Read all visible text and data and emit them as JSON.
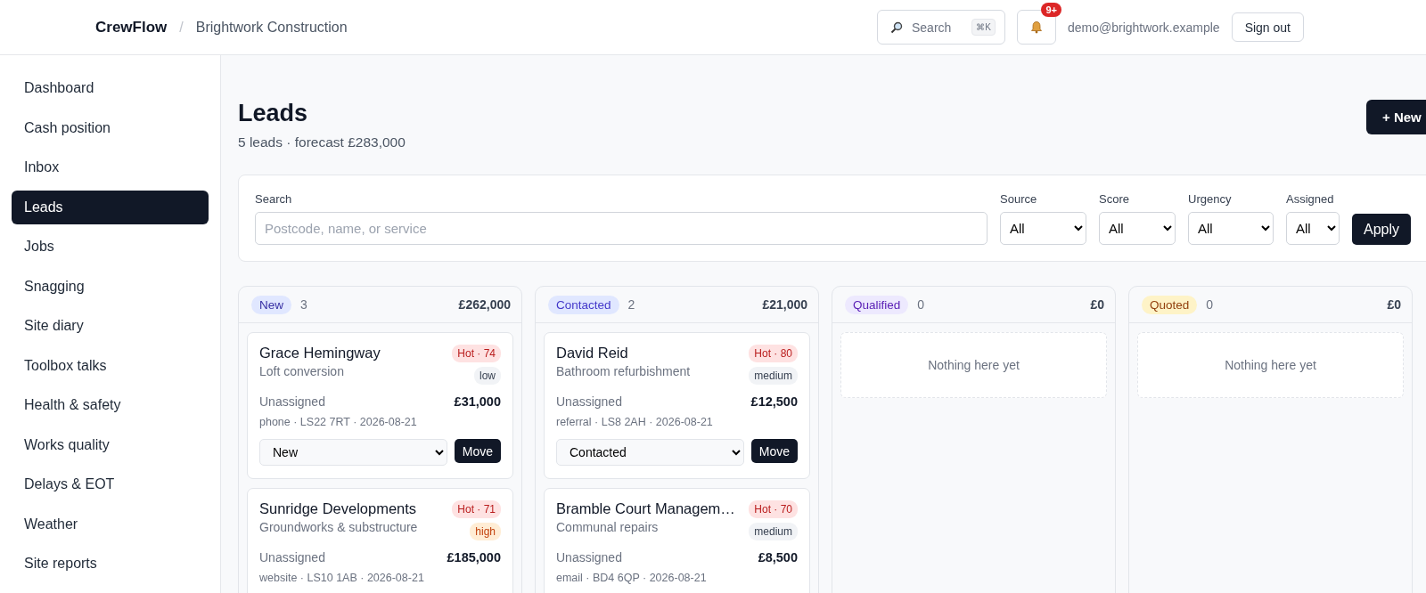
{
  "header": {
    "brand": "CrewFlow",
    "separator": "/",
    "org": "Brightwork Construction",
    "search": {
      "label": "Search",
      "shortcut": "⌘K"
    },
    "notifications": {
      "badge": "9+"
    },
    "user_email": "demo@brightwork.example",
    "sign_out": "Sign out"
  },
  "sidebar": {
    "items": [
      {
        "label": "Dashboard",
        "selected": false
      },
      {
        "label": "Cash position",
        "selected": false
      },
      {
        "label": "Inbox",
        "selected": false
      },
      {
        "label": "Leads",
        "selected": true
      },
      {
        "label": "Jobs",
        "selected": false
      },
      {
        "label": "Snagging",
        "selected": false
      },
      {
        "label": "Site diary",
        "selected": false
      },
      {
        "label": "Toolbox talks",
        "selected": false
      },
      {
        "label": "Health & safety",
        "selected": false
      },
      {
        "label": "Works quality",
        "selected": false
      },
      {
        "label": "Delays & EOT",
        "selected": false
      },
      {
        "label": "Weather",
        "selected": false
      },
      {
        "label": "Site reports",
        "selected": false
      }
    ]
  },
  "page": {
    "title": "Leads",
    "subtitle": "5 leads · forecast £283,000",
    "new_button": "+ New"
  },
  "filters": {
    "search": {
      "label": "Search",
      "placeholder": "Postcode, name, or service"
    },
    "selects": [
      {
        "label": "Source",
        "value": "All"
      },
      {
        "label": "Score",
        "value": "All"
      },
      {
        "label": "Urgency",
        "value": "All"
      },
      {
        "label": "Assigned",
        "value": "All"
      }
    ],
    "apply": "Apply"
  },
  "columns": [
    {
      "stage": "New",
      "kind": "new",
      "count": "3",
      "total": "£262,000",
      "leads": [
        {
          "name": "Grace Hemingway",
          "service": "Loft conversion",
          "score": "Hot · 74",
          "urgency": "low",
          "urgent": false,
          "assignee": "Unassigned",
          "value": "£31,000",
          "meta": "phone · LS22 7RT · 2026-08-21",
          "stage_select": "New",
          "move": "Move"
        },
        {
          "name": "Sunridge Developments",
          "service": "Groundworks & substructure",
          "score": "Hot · 71",
          "urgency": "high",
          "urgent": true,
          "assignee": "Unassigned",
          "value": "£185,000",
          "meta": "website · LS10 1AB · 2026-08-21"
        }
      ]
    },
    {
      "stage": "Contacted",
      "kind": "contacted",
      "count": "2",
      "total": "£21,000",
      "leads": [
        {
          "name": "David Reid",
          "service": "Bathroom refurbishment",
          "score": "Hot · 80",
          "urgency": "medium",
          "urgent": false,
          "assignee": "Unassigned",
          "value": "£12,500",
          "meta": "referral · LS8 2AH · 2026-08-21",
          "stage_select": "Contacted",
          "move": "Move"
        },
        {
          "name": "Bramble Court Managem…",
          "service": "Communal repairs",
          "score": "Hot · 70",
          "urgency": "medium",
          "urgent": false,
          "assignee": "Unassigned",
          "value": "£8,500",
          "meta": "email · BD4 6QP · 2026-08-21"
        }
      ]
    },
    {
      "stage": "Qualified",
      "kind": "qualified",
      "count": "0",
      "total": "£0",
      "empty": "Nothing here yet"
    },
    {
      "stage": "Quoted",
      "kind": "quoted",
      "count": "0",
      "total": "£0",
      "empty": "Nothing here yet"
    }
  ]
}
